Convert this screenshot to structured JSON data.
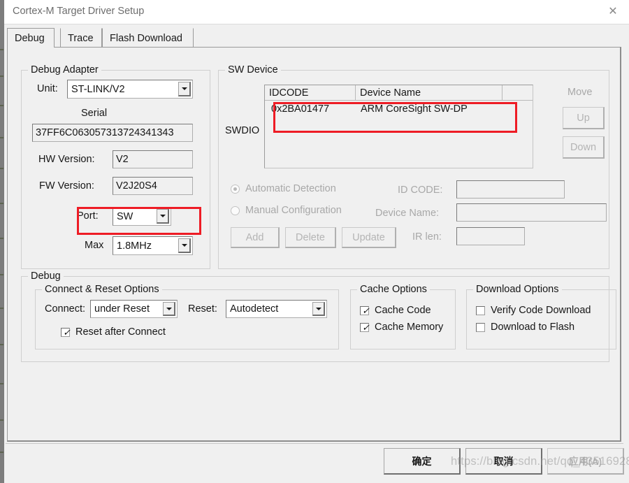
{
  "window": {
    "title": "Cortex-M Target Driver Setup",
    "close_icon": "close-icon"
  },
  "tabs": [
    {
      "label": "Debug",
      "active": true
    },
    {
      "label": "Trace",
      "active": false
    },
    {
      "label": "Flash Download",
      "active": false
    }
  ],
  "debug_adapter": {
    "legend": "Debug Adapter",
    "unit_label": "Unit:",
    "unit_value": "ST-LINK/V2",
    "serial_label": "Serial",
    "serial_value": "37FF6C063057313724341343",
    "hw_version_label": "HW Version:",
    "hw_version_value": "V2",
    "fw_version_label": "FW Version:",
    "fw_version_value": "V2J20S4",
    "port_label": "Port:",
    "port_value": "SW",
    "max_label": "Max",
    "max_value": "1.8MHz"
  },
  "sw_device": {
    "legend": "SW Device",
    "swdio_label": "SWDIO",
    "columns": [
      "IDCODE",
      "Device Name",
      ""
    ],
    "rows": [
      {
        "idcode": "0x2BA01477",
        "device_name": "ARM CoreSight SW-DP"
      }
    ],
    "move_label": "Move",
    "up_label": "Up",
    "down_label": "Down",
    "automatic_detection_label": "Automatic Detection",
    "manual_configuration_label": "Manual Configuration",
    "automatic_detection_selected": true,
    "id_code_label": "ID CODE:",
    "id_code_value": "",
    "device_name_label": "Device Name:",
    "device_name_value": "",
    "ir_len_label": "IR len:",
    "ir_len_value": "",
    "add_label": "Add",
    "delete_label": "Delete",
    "update_label": "Update"
  },
  "debug": {
    "legend": "Debug",
    "connect_reset": {
      "legend": "Connect & Reset Options",
      "connect_label": "Connect:",
      "connect_value": "under Reset",
      "reset_label": "Reset:",
      "reset_value": "Autodetect",
      "reset_after_connect_label": "Reset after Connect",
      "reset_after_connect_checked": true
    },
    "cache_options": {
      "legend": "Cache Options",
      "cache_code_label": "Cache Code",
      "cache_code_checked": true,
      "cache_memory_label": "Cache Memory",
      "cache_memory_checked": true
    },
    "download_options": {
      "legend": "Download Options",
      "verify_code_download_label": "Verify Code Download",
      "verify_code_download_checked": false,
      "download_to_flash_label": "Download to Flash",
      "download_to_flash_checked": false
    }
  },
  "footer": {
    "ok_label": "确定",
    "cancel_label": "取消",
    "apply_label": "应用(A)"
  },
  "watermark": {
    "text": "https://blog.csdn.net/qq_43516928"
  },
  "colors": {
    "annotation_red": "#ee1c25",
    "dialog_bg": "#f0f0f0",
    "titlebar_bg": "#ffffff"
  }
}
